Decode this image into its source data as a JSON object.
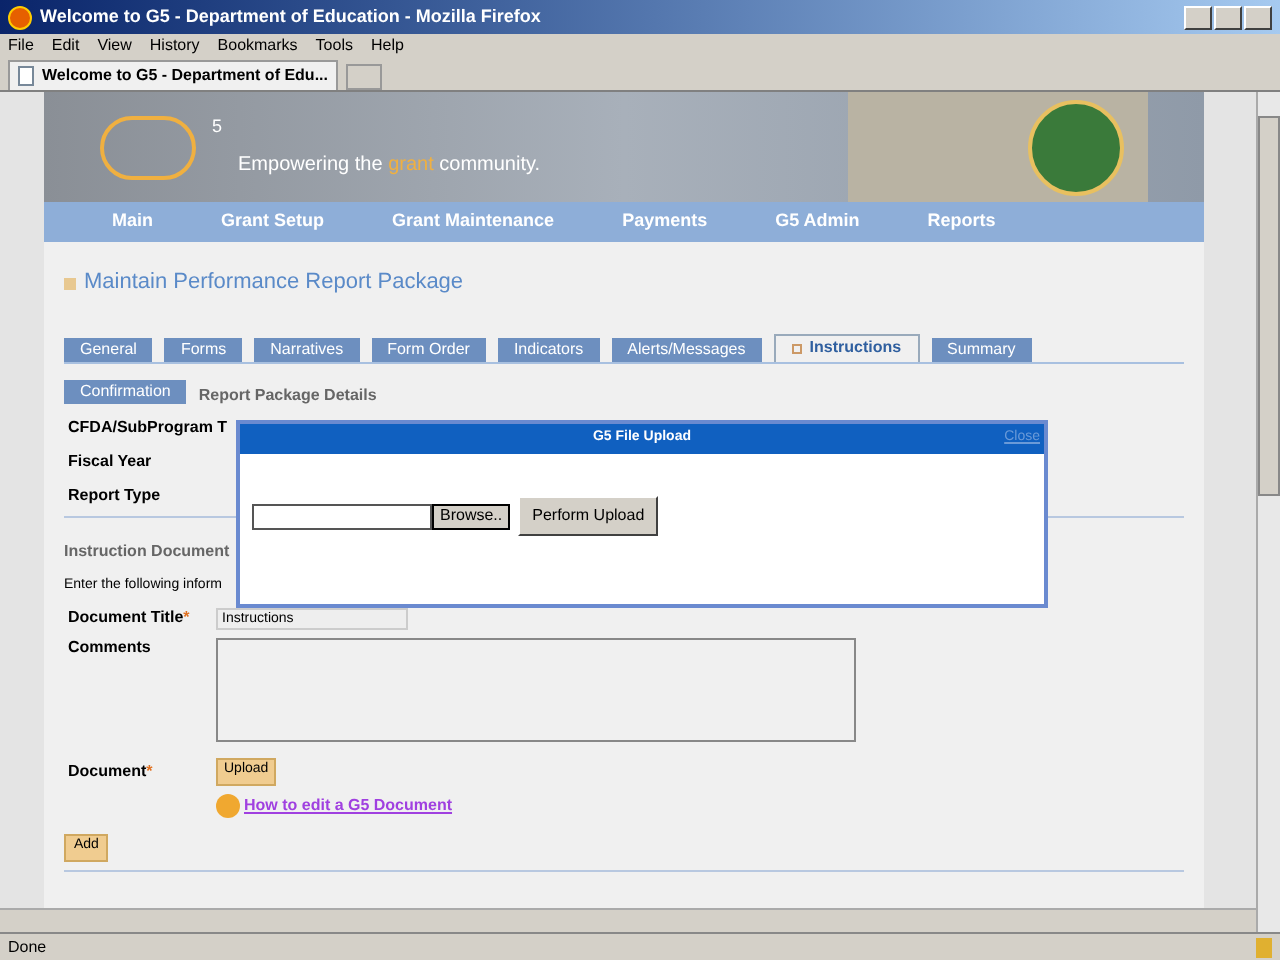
{
  "window": {
    "title": "Welcome to G5 - Department of Education - Mozilla Firefox"
  },
  "menu": [
    "File",
    "Edit",
    "View",
    "History",
    "Bookmarks",
    "Tools",
    "Help"
  ],
  "browser_tab": {
    "label": "Welcome to G5 - Department of Edu..."
  },
  "header": {
    "logo_sup": "5",
    "tagline_before": "Empowering the ",
    "tagline_highlight": "grant",
    "tagline_after": " community."
  },
  "nav": [
    "Main",
    "Grant Setup",
    "Grant Maintenance",
    "Payments",
    "G5 Admin",
    "Reports"
  ],
  "page_title": "Maintain Performance Report Package",
  "tabs": [
    {
      "label": "General",
      "selected": false
    },
    {
      "label": "Forms",
      "selected": false
    },
    {
      "label": "Narratives",
      "selected": false
    },
    {
      "label": "Form Order",
      "selected": false
    },
    {
      "label": "Indicators",
      "selected": false
    },
    {
      "label": "Alerts/Messages",
      "selected": false
    },
    {
      "label": "Instructions",
      "selected": true
    },
    {
      "label": "Summary",
      "selected": false
    },
    {
      "label": "Confirmation",
      "selected": false
    }
  ],
  "section_title": "Report Package Details",
  "details": [
    "CFDA/SubProgram T",
    "Fiscal Year",
    "Report Type"
  ],
  "instruction_heading": "Instruction Document",
  "instruction_text": "Enter the following inform",
  "form": {
    "title_label": "Document Title",
    "title_value": "Instructions",
    "comments_label": "Comments",
    "document_label": "Document",
    "required_mark": "*",
    "upload": "Upload",
    "help_link": "How to edit a G5 Document",
    "add": "Add"
  },
  "dialog": {
    "title": "G5 File Upload",
    "close": "Close",
    "browse": "Browse..",
    "perform": "Perform Upload"
  },
  "status_bar": "Done"
}
